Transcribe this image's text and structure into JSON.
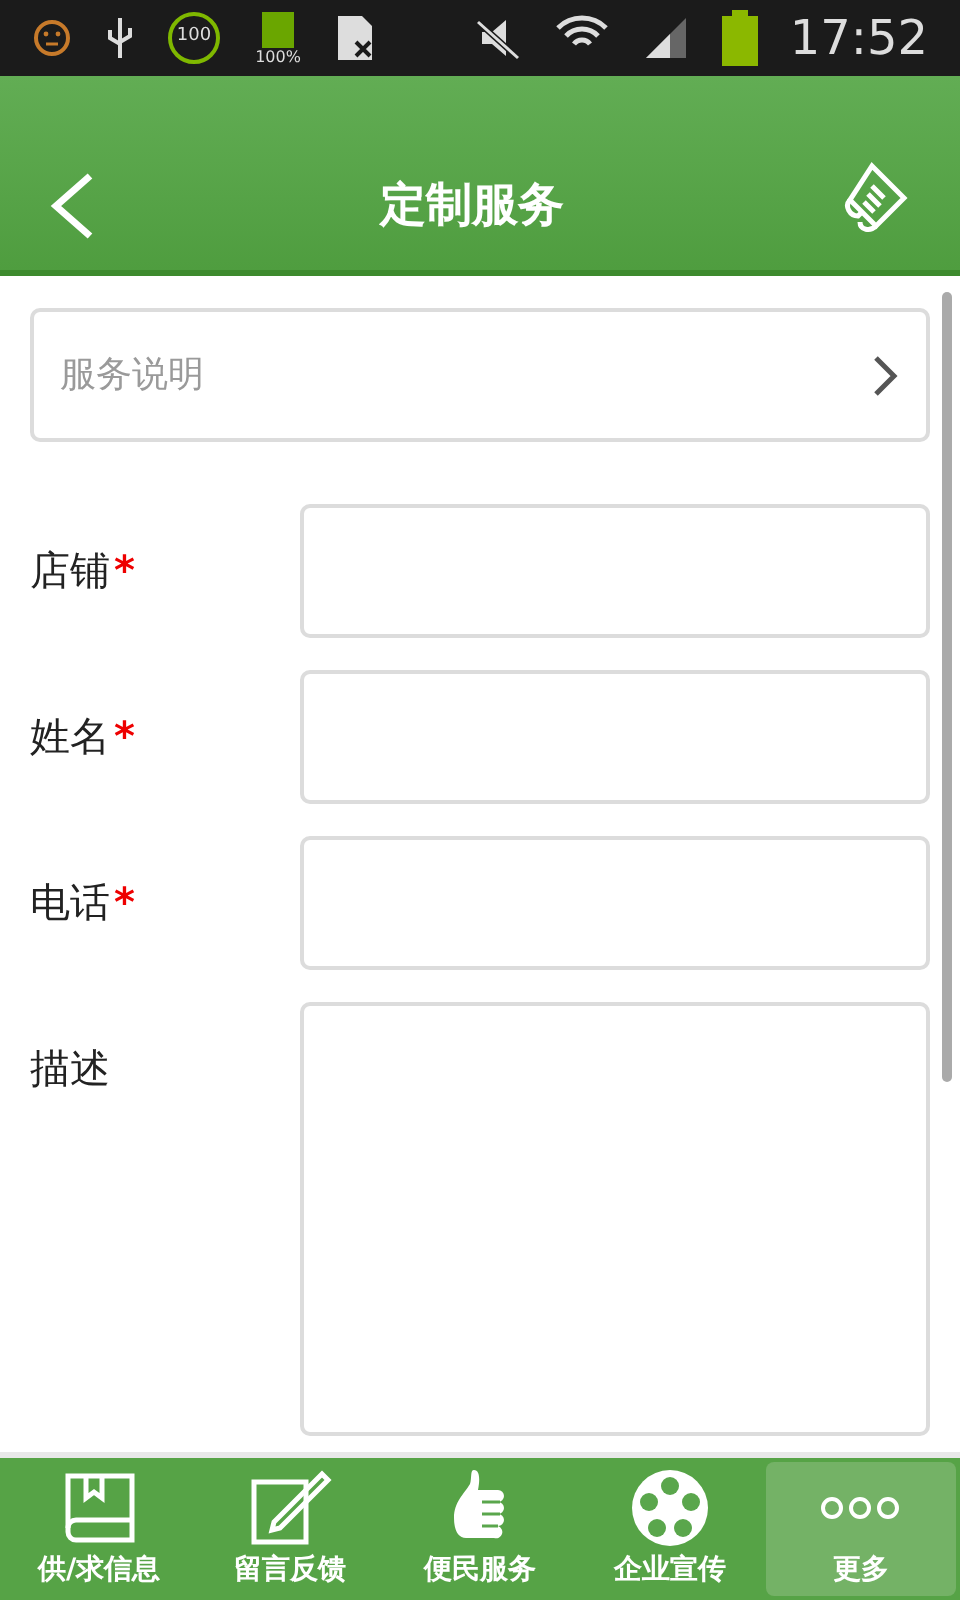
{
  "status_bar": {
    "ring_badge": "100",
    "battery_badge": "100%",
    "time": "17:52"
  },
  "header": {
    "title": "定制服务"
  },
  "service_row": {
    "label": "服务说明"
  },
  "fields": [
    {
      "label": "店铺",
      "required": true,
      "kind": "input"
    },
    {
      "label": "姓名",
      "required": true,
      "kind": "input"
    },
    {
      "label": "电话",
      "required": true,
      "kind": "input"
    },
    {
      "label": "描述",
      "required": false,
      "kind": "textarea"
    }
  ],
  "required_mark": "*",
  "nav": [
    {
      "label": "供/求信息",
      "kind": "book",
      "selected": false
    },
    {
      "label": "留言反馈",
      "kind": "edit",
      "selected": false
    },
    {
      "label": "便民服务",
      "kind": "thumb",
      "selected": false
    },
    {
      "label": "企业宣传",
      "kind": "reel",
      "selected": false
    },
    {
      "label": "更多",
      "kind": "more",
      "selected": true
    }
  ]
}
